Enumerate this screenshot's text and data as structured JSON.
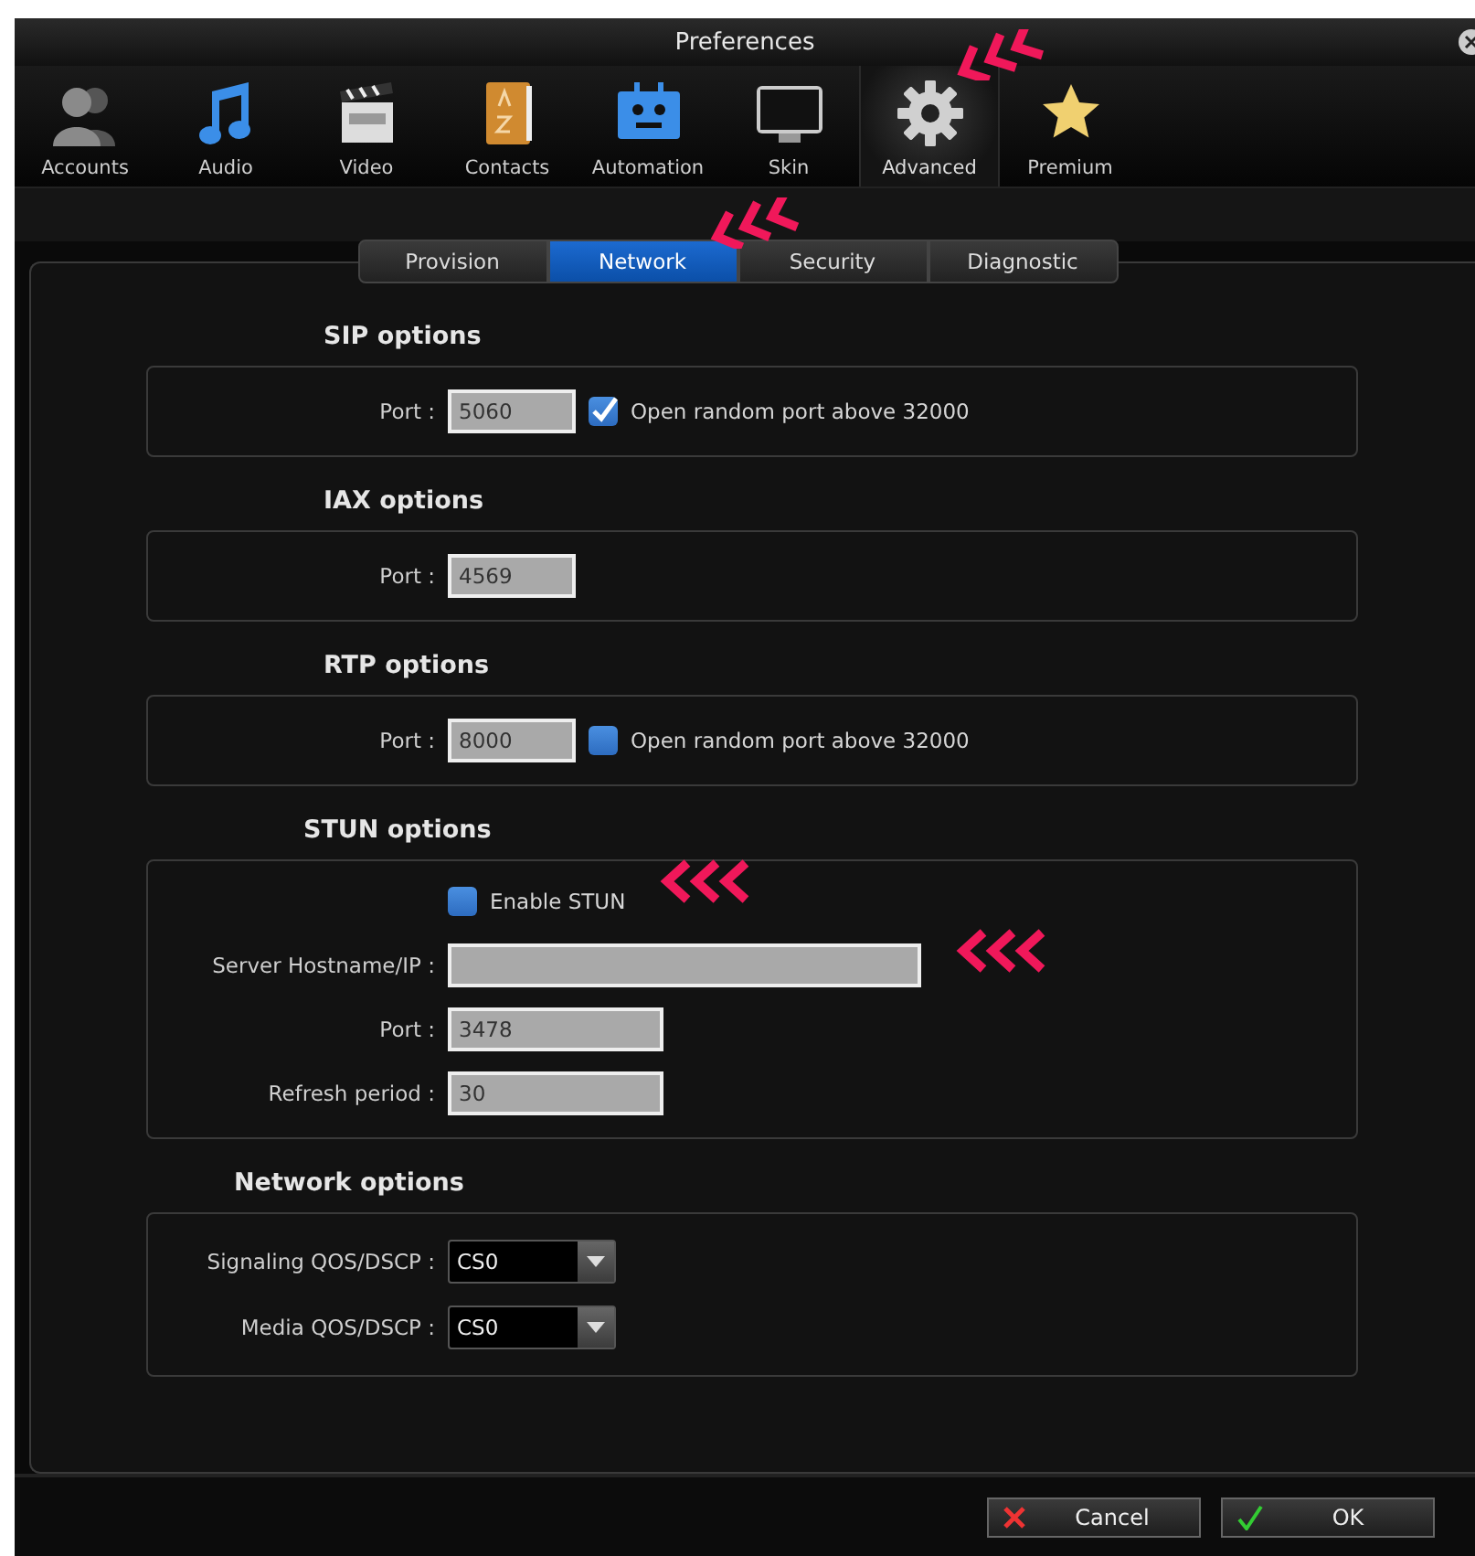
{
  "window": {
    "title": "Preferences"
  },
  "toolbar": [
    {
      "label": "Accounts",
      "kind": "people",
      "selected": false
    },
    {
      "label": "Audio",
      "kind": "note",
      "selected": false
    },
    {
      "label": "Video",
      "kind": "clapper",
      "selected": false
    },
    {
      "label": "Contacts",
      "kind": "book",
      "selected": false
    },
    {
      "label": "Automation",
      "kind": "robot",
      "selected": false
    },
    {
      "label": "Skin",
      "kind": "monitor",
      "selected": false
    },
    {
      "label": "Advanced",
      "kind": "gear",
      "selected": true
    },
    {
      "label": "Premium",
      "kind": "star",
      "selected": false
    }
  ],
  "tabs": [
    {
      "label": "Provision",
      "selected": false
    },
    {
      "label": "Network",
      "selected": true
    },
    {
      "label": "Security",
      "selected": false
    },
    {
      "label": "Diagnostic",
      "selected": false
    }
  ],
  "sections": [
    {
      "title": "SIP options",
      "rows": [
        {
          "kind": "short-field",
          "label": "Port :",
          "value": "5060",
          "checkbox": {
            "label": "Open random port above 32000",
            "checked": true
          }
        }
      ]
    },
    {
      "title": "IAX options",
      "rows": [
        {
          "kind": "short-field",
          "label": "Port :",
          "value": "4569"
        }
      ]
    },
    {
      "title": "RTP options",
      "rows": [
        {
          "kind": "short-field",
          "label": "Port :",
          "value": "8000",
          "checkbox": {
            "label": "Open random port above 32000",
            "checked": false
          }
        }
      ]
    },
    {
      "title": "STUN options",
      "rows": [
        {
          "kind": "checkbox",
          "label": "Enable STUN",
          "checked": false
        },
        {
          "kind": "long-field",
          "label": "Server Hostname/IP :"
        },
        {
          "kind": "field",
          "label": "Port :",
          "value": "3478"
        },
        {
          "kind": "field",
          "label": "Refresh period :",
          "value": "30"
        }
      ]
    },
    {
      "title": "Network options",
      "rows": [
        {
          "kind": "select",
          "label": "Signaling QOS/DSCP :",
          "value": "CS0"
        },
        {
          "kind": "select",
          "label": "Media QOS/DSCP :",
          "value": "CS0"
        }
      ]
    }
  ],
  "buttons": [
    {
      "label": "Cancel",
      "kind": "cancel"
    },
    {
      "label": "OK",
      "kind": "ok"
    }
  ]
}
